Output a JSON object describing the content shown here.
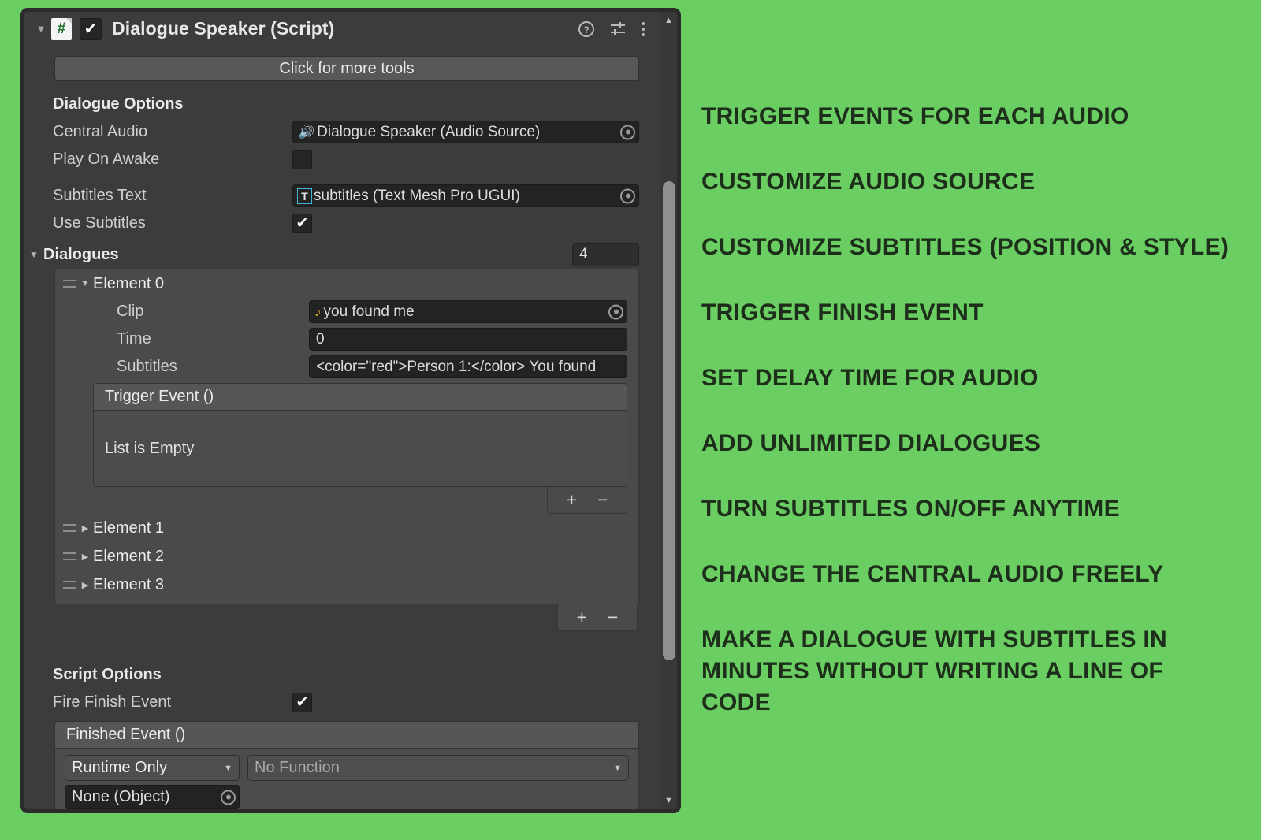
{
  "component": {
    "title": "Dialogue Speaker (Script)",
    "script_icon": "csharp-script-icon",
    "enabled_checkmark": "✔",
    "foldout_arrow": "▼",
    "help_icon": "help-icon",
    "preset_icon": "preset-icon",
    "menu_icon": "kebab-menu-icon",
    "tools_button": "Click for more tools"
  },
  "dialogue_options": {
    "header": "Dialogue Options",
    "central_audio": {
      "label": "Central Audio",
      "value": "Dialogue Speaker (Audio Source)",
      "icon": "audio-source-icon"
    },
    "play_on_awake": {
      "label": "Play On Awake",
      "checked": false,
      "mark": ""
    },
    "subtitles_text": {
      "label": "Subtitles Text",
      "value": "subtitles (Text Mesh Pro UGUI)",
      "icon": "text-mesh-pro-icon",
      "icon_glyph": "T"
    },
    "use_subtitles": {
      "label": "Use Subtitles",
      "checked": true,
      "mark": "✔"
    }
  },
  "dialogues": {
    "label": "Dialogues",
    "count": "4",
    "foldout_arrow": "▼",
    "element0": {
      "name": "Element 0",
      "foldout_arrow": "▼",
      "clip": {
        "label": "Clip",
        "value": "you found me",
        "icon": "audio-clip-icon",
        "glyph": "♪"
      },
      "time": {
        "label": "Time",
        "value": "0"
      },
      "subtitles": {
        "label": "Subtitles",
        "value": "<color=\"red\">Person 1:</color> You found"
      },
      "trigger_event": {
        "title": "Trigger Event ()",
        "empty_text": "List is Empty",
        "add_label": "+",
        "remove_label": "−"
      }
    },
    "collapsed_elements": [
      {
        "name": "Element 1",
        "foldout_arrow": "▶"
      },
      {
        "name": "Element 2",
        "foldout_arrow": "▶"
      },
      {
        "name": "Element 3",
        "foldout_arrow": "▶"
      }
    ],
    "add_label": "+",
    "remove_label": "−"
  },
  "script_options": {
    "header": "Script Options",
    "fire_finish_event": {
      "label": "Fire Finish Event",
      "checked": true,
      "mark": "✔"
    },
    "finished_event": {
      "title": "Finished Event ()",
      "listener_mode": "Runtime Only",
      "function": "No Function",
      "target_object": "None (Object)",
      "caret": "▼"
    }
  },
  "scrollbar": {
    "up_arrow": "▲",
    "down_arrow": "▼"
  },
  "features": {
    "items": [
      "TRIGGER EVENTS FOR EACH AUDIO",
      "CUSTOMIZE AUDIO SOURCE",
      "CUSTOMIZE SUBTITLES (POSITION & STYLE)",
      "TRIGGER FINISH EVENT",
      "SET DELAY TIME FOR AUDIO",
      "ADD UNLIMITED DIALOGUES",
      "TURN SUBTITLES ON/OFF ANYTIME",
      "CHANGE THE CENTRAL AUDIO FREELY",
      "MAKE A DIALOGUE WITH SUBTITLES IN MINUTES WITHOUT WRITING A LINE OF CODE"
    ]
  },
  "colors": {
    "background_green": "#6ACE62",
    "panel_bg": "#3c3c3c",
    "field_bg": "#232323",
    "list_bg": "#4a4a4a",
    "text": "#e8e8e8",
    "feature_text": "#1d2e1b",
    "audio_icon": "#e3b228",
    "tmp_icon": "#3fb6d6"
  }
}
